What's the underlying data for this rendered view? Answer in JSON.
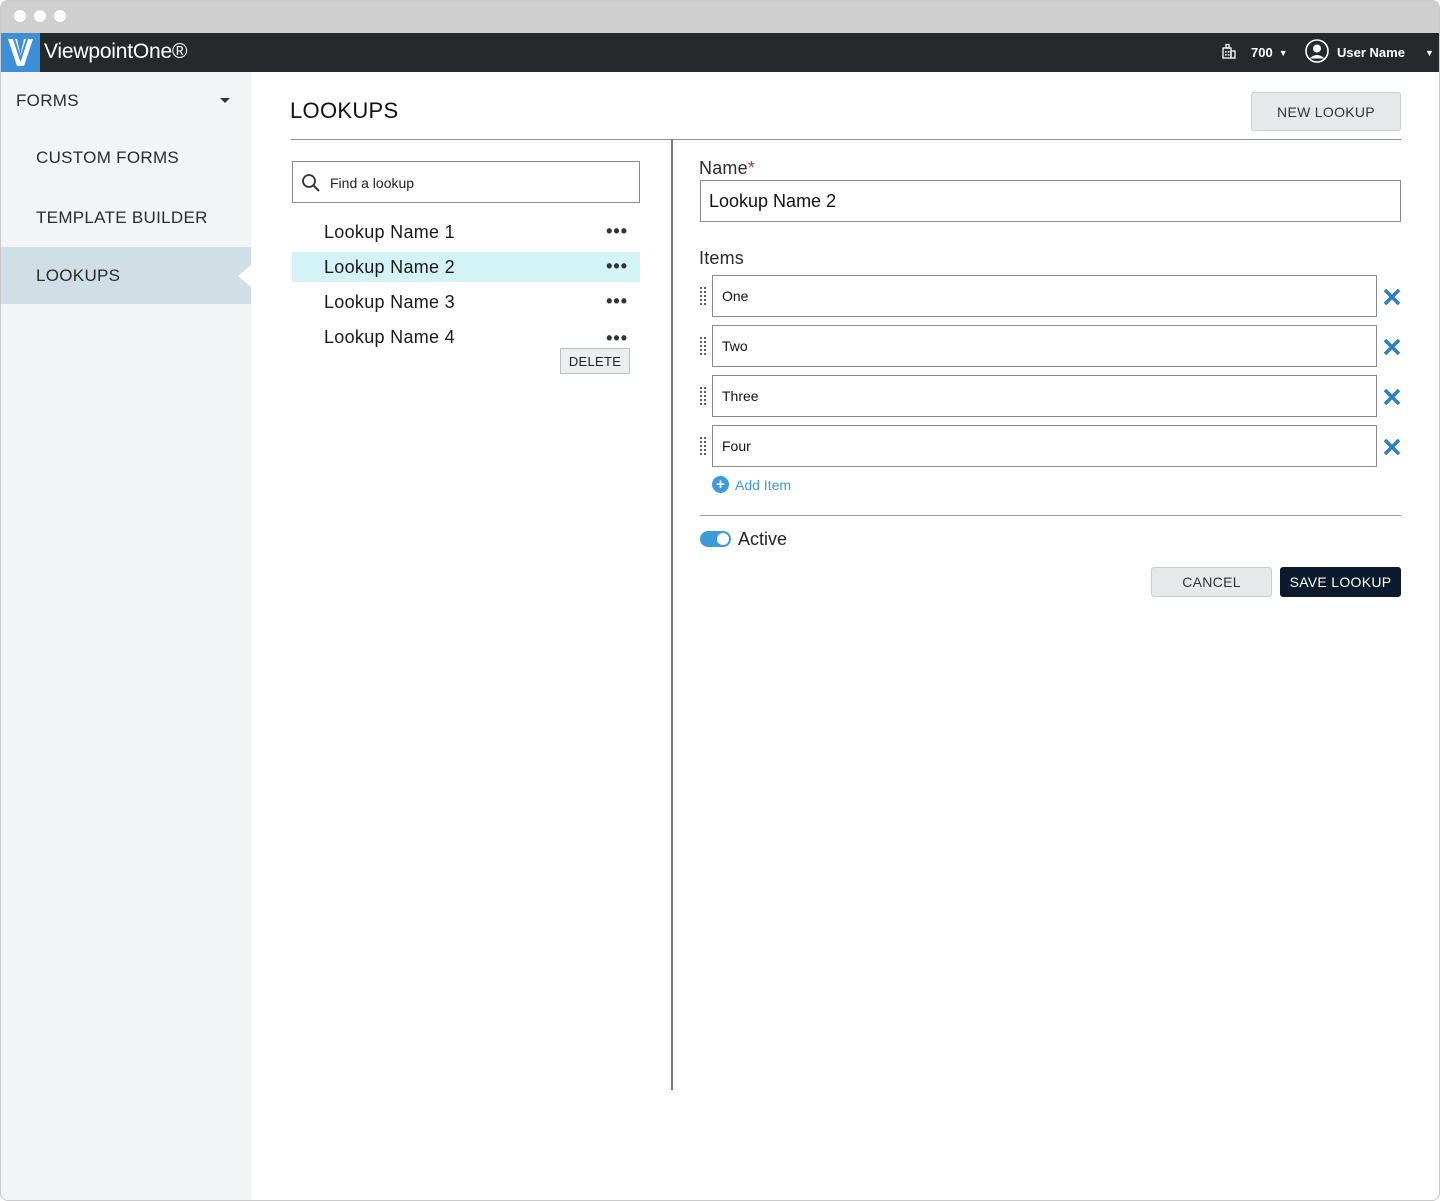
{
  "app": {
    "title": "ViewpointOne®",
    "company_number": "700",
    "user_name": "User Name"
  },
  "sidebar": {
    "section": "FORMS",
    "items": [
      {
        "label": "CUSTOM FORMS",
        "active": false
      },
      {
        "label": "TEMPLATE BUILDER",
        "active": false
      },
      {
        "label": "LOOKUPS",
        "active": true
      }
    ]
  },
  "page": {
    "title": "LOOKUPS",
    "new_button": "NEW LOOKUP"
  },
  "search": {
    "placeholder": "Find a lookup"
  },
  "lookups": [
    {
      "name": "Lookup Name 1",
      "selected": false
    },
    {
      "name": "Lookup Name 2",
      "selected": true
    },
    {
      "name": "Lookup Name 3",
      "selected": false
    },
    {
      "name": "Lookup Name 4",
      "selected": false
    }
  ],
  "row_menu": {
    "more_glyph": "•••",
    "delete_label": "DELETE"
  },
  "form": {
    "name_label": "Name",
    "required_mark": "*",
    "name_value": "Lookup Name 2",
    "items_label": "Items",
    "items": [
      "One",
      "Two",
      "Three",
      "Four"
    ],
    "add_item_label": "Add Item",
    "active_label": "Active",
    "active": true,
    "cancel_label": "CANCEL",
    "save_label": "SAVE LOOKUP"
  },
  "colors": {
    "appbar": "#25292c",
    "accent": "#3d9bd9",
    "selected_row": "#d4f3f7",
    "sidebar_active": "#d0dee6",
    "save_button": "#0c1a2e"
  }
}
